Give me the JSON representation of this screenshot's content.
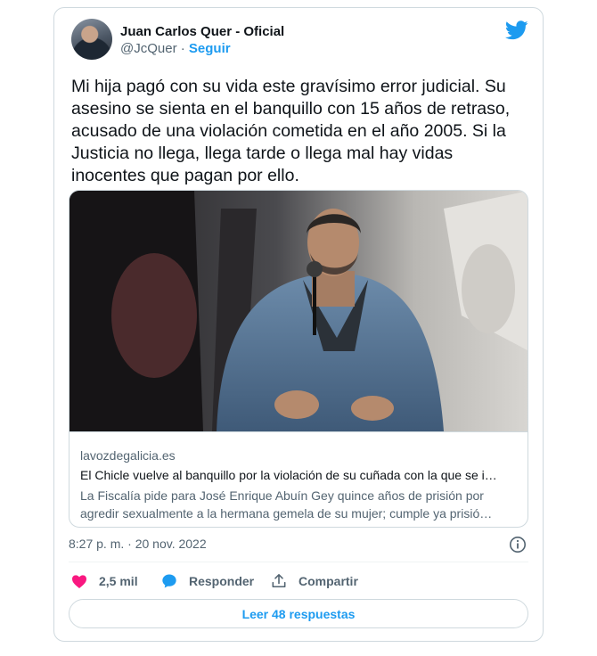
{
  "author": {
    "name": "Juan Carlos Quer - Oficial",
    "handle": "@JcQuer",
    "separator": " · ",
    "follow_label": "Seguir"
  },
  "tweet": {
    "lines": [
      "Mi hija pagó con su vida este gravísimo error judicial. Su",
      "asesino se sienta en el banquillo con 15 años de retraso,",
      "acusado de una violación cometida en el año 2005. Si la",
      "Justicia no llega, llega tarde o llega mal hay vidas",
      "inocentes que pagan por ello."
    ]
  },
  "link_card": {
    "domain": "lavozdegalicia.es",
    "title": "El Chicle vuelve al banquillo por la violación de su cuñada con la que se i…",
    "description_lines": [
      "La Fiscalía pide para José Enrique Abuín Gey quince años de prisión por",
      "agredir sexualmente a la hermana gemela de su mujer; cumple ya prisió…"
    ]
  },
  "timestamp": "8:27 p. m. · 20 nov. 2022",
  "actions": {
    "like_count": "2,5 mil",
    "reply_label": "Responder",
    "share_label": "Compartir"
  },
  "read_replies_label": "Leer 48 respuestas",
  "colors": {
    "accent": "#1d9bf0",
    "like": "#f91880",
    "text": "#0f1419",
    "muted": "#536471",
    "border": "#cfd9de"
  },
  "icons": [
    "twitter-bird-icon",
    "info-icon",
    "heart-icon",
    "reply-bubble-icon",
    "share-icon"
  ]
}
